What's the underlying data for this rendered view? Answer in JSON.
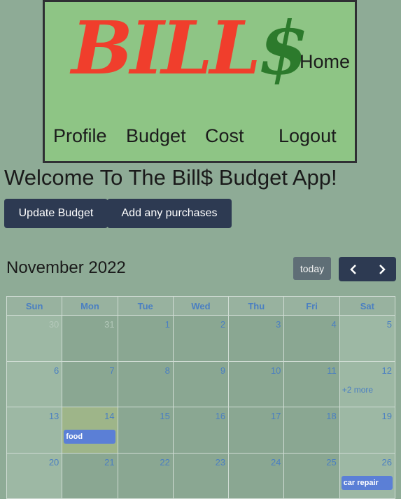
{
  "header": {
    "logo_text": "BILL",
    "logo_dollar": "$",
    "nav": {
      "home": "Home",
      "profile": "Profile",
      "budget": "Budget",
      "cost": "Cost",
      "logout": "Logout"
    }
  },
  "welcome": "Welcome To The Bill$ Budget App!",
  "buttons": {
    "update_budget": "Update Budget",
    "add_purchases": "Add any purchases"
  },
  "calendar": {
    "title": "November 2022",
    "today_label": "today",
    "prev_icon": "chevron-left-icon",
    "next_icon": "chevron-right-icon",
    "weekdays": [
      "Sun",
      "Mon",
      "Tue",
      "Wed",
      "Thu",
      "Fri",
      "Sat"
    ],
    "weeks": [
      [
        "30",
        "31",
        "1",
        "2",
        "3",
        "4",
        "5"
      ],
      [
        "6",
        "7",
        "8",
        "9",
        "10",
        "11",
        "12"
      ],
      [
        "13",
        "14",
        "15",
        "16",
        "17",
        "18",
        "19"
      ],
      [
        "20",
        "21",
        "22",
        "23",
        "24",
        "25",
        "26"
      ]
    ],
    "events": {
      "food": "food",
      "car_repair": "car repair"
    },
    "more_link": "+2 more"
  },
  "colors": {
    "page_bg": "#8eab96",
    "header_bg": "#8ec585",
    "logo_red": "#f03e2c",
    "logo_green": "#2c7a2c",
    "button_dark": "#2d3a52",
    "event_blue": "#5b7fd6",
    "link_blue": "#4a7fc2"
  }
}
